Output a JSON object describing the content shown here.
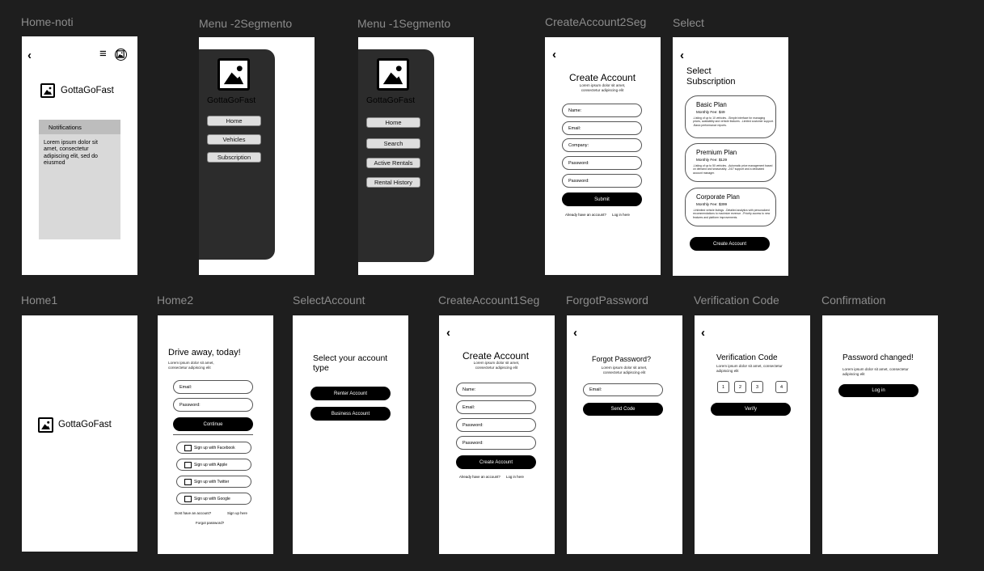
{
  "labels": {
    "home_noti": "Home-noti",
    "menu2": "Menu -2Segmento",
    "menu1": "Menu -1Segmento",
    "create2": "CreateAccount2Seg",
    "select": "Select",
    "home1": "Home1",
    "home2": "Home2",
    "select_account": "SelectAccount",
    "create1": "CreateAccount1Seg",
    "forgot": "ForgotPassword",
    "verification": "Verification Code",
    "confirmation": "Confirmation"
  },
  "brand": "GottaGoFast",
  "home_noti": {
    "back": "‹",
    "menu": "≡",
    "notifications_title": "Notifications",
    "notifications_body": "Lorem ipsum dolor sit amet, consectetur adipiscing elit, sed do eiusmod"
  },
  "menu2": {
    "items": [
      "Home",
      "Vehicles",
      "Subscription"
    ]
  },
  "menu1": {
    "items": [
      "Home",
      "Search",
      "Active Rentals",
      "Rental History"
    ]
  },
  "create2": {
    "back": "‹",
    "title": "Create Account",
    "subtitle": "Lorem ipsum dolor sit amet, consectetur adipiscing elit",
    "fields": [
      "Name:",
      "Email:",
      "Company:",
      "Password:",
      "Password:"
    ],
    "submit": "Submit",
    "footer_q": "Already have an account?",
    "footer_link": "Log in here"
  },
  "select": {
    "back": "‹",
    "title": "Select Subscription",
    "plans": [
      {
        "name": "Basic Plan",
        "fee": "Monthly Fee:  $49",
        "desc": "-Listing of up to 10 vehicles. -Simple interface for managing prices, availability and vehicle features. -Limited customer support. -Basic performance reports."
      },
      {
        "name": "Premium Plan",
        "fee": "Monthly Fee:  $129",
        "desc": "-Listing of up to 50 vehicles. -Automatic price management based on demand and seasonality. -24/7 support and a dedicated account manager."
      },
      {
        "name": "Corporate Plan",
        "fee": "Monthly Fee:  $399",
        "desc": "-Unlimited vehicle listings. -Detailed analytics with personalized recommendations to maximize revenue. -Priority access to new features and platform improvements."
      }
    ],
    "button": "Create Account"
  },
  "home2": {
    "title": "Drive away, today!",
    "subtitle": "Lorem ipsum dolor sit amet, consectetur adipiscing elit",
    "email": "Email:",
    "password": "Password:",
    "continue": "Continue",
    "socials": [
      "Sign up with Facebook",
      "Sign up with Apple",
      "Sign up with Twitter",
      "Sign up with Google"
    ],
    "no_account": "Dont have an account?",
    "signup": "Sign up here",
    "forgot": "Forgot password?"
  },
  "select_account": {
    "title": "Select your account type",
    "renter": "Renter Account",
    "business": "Business Account"
  },
  "create1": {
    "back": "‹",
    "title": "Create Account",
    "subtitle": "Lorem ipsum dolor sit amet, consectetur adipiscing elit",
    "fields": [
      "Name:",
      "Email:",
      "Password:",
      "Password:"
    ],
    "button": "Create Account",
    "footer_q": "Already have an account?",
    "footer_link": "Log in here"
  },
  "forgot": {
    "back": "‹",
    "title": "Forgot Password?",
    "subtitle": "Lorem ipsum dolor sit amet, consectetur adipiscing elit",
    "email": "Email:",
    "button": "Send Code"
  },
  "verification": {
    "back": "‹",
    "title": "Verification Code",
    "subtitle": "Lorem ipsum dolor sit amet, consectetur adipiscing elit",
    "digits": [
      "1",
      "2",
      "3",
      "4"
    ],
    "button": "Verify"
  },
  "confirmation": {
    "title": "Password changed!",
    "subtitle": "Lorem ipsum dolor sit amet, consectetur adipiscing elit",
    "button": "Log in"
  }
}
